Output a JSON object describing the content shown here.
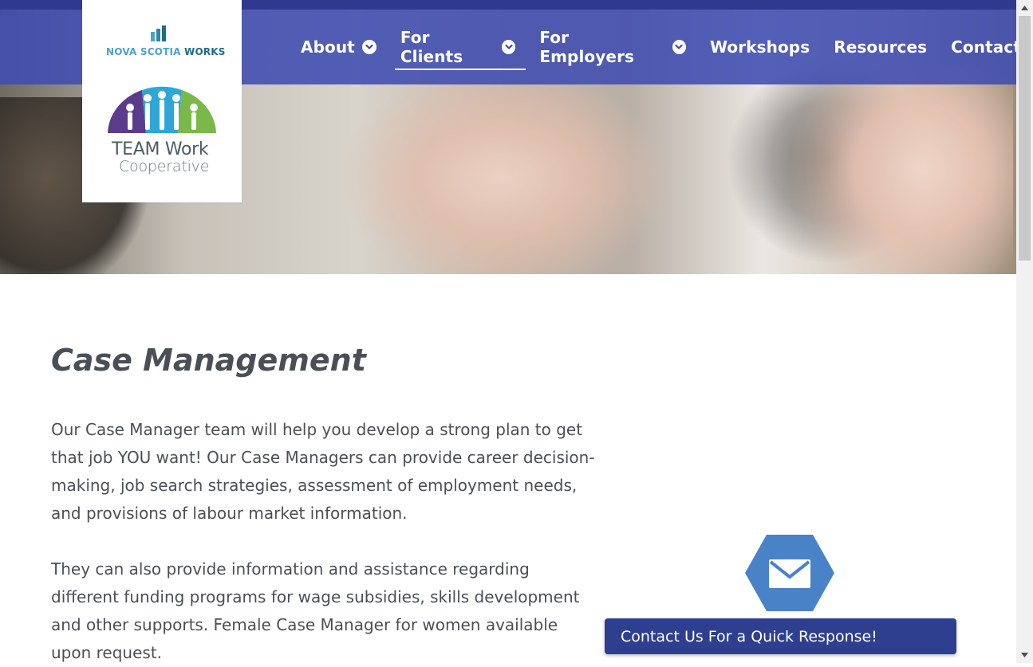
{
  "nav": {
    "items": [
      {
        "label": "About",
        "has_dropdown": true,
        "active": false
      },
      {
        "label": "For Clients",
        "has_dropdown": true,
        "active": true
      },
      {
        "label": "For Employers",
        "has_dropdown": true,
        "active": false
      },
      {
        "label": "Workshops",
        "has_dropdown": false,
        "active": false
      },
      {
        "label": "Resources",
        "has_dropdown": false,
        "active": false
      },
      {
        "label": "Contact",
        "has_dropdown": false,
        "active": false
      }
    ]
  },
  "logo": {
    "nsw_part1": "NOVA SCOTIA ",
    "nsw_part2": "WORKS",
    "team_title": "TEAM Work",
    "team_sub": "Cooperative"
  },
  "main": {
    "title": "Case Management",
    "paragraph1": "Our Case Manager team will help you develop a strong plan to get that job YOU want! Our Case Managers can provide career decision-making, job search strategies, assessment of employment needs, and provisions of labour market information.",
    "paragraph2": "They can also provide information and assistance regarding different funding programs for wage subsidies, skills development and other supports.  Female Case Manager for women available upon request."
  },
  "contact_widget": {
    "label": "Contact Us For a Quick Response!",
    "icon": "envelope-icon"
  },
  "colors": {
    "nav_bg": "#3f4cb0",
    "contact_bar": "#2e3f8f",
    "hex_blue": "#4a82c8",
    "text": "#4a4f57"
  }
}
